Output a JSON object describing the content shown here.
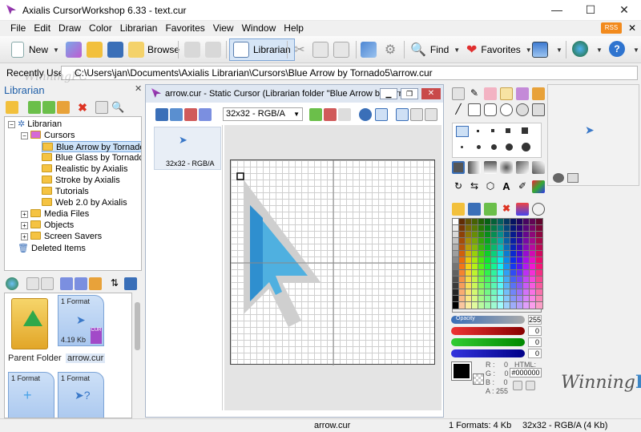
{
  "window": {
    "title": "Axialis CursorWorkshop 6.33 - text.cur",
    "controls": [
      "—",
      "☐",
      "✕"
    ]
  },
  "menu": [
    "File",
    "Edit",
    "Draw",
    "Color",
    "Librarian",
    "Favorites",
    "View",
    "Window",
    "Help"
  ],
  "rss_label": "RSS",
  "toolbar": {
    "new": "New",
    "browse": "Browse",
    "librarian": "Librarian",
    "find": "Find",
    "favorites": "Favorites"
  },
  "recent": {
    "label": "Recently Used",
    "path": "C:\\Users\\jan\\Documents\\Axialis Librarian\\Cursors\\Blue Arrow by Tornado5\\arrow.cur"
  },
  "librarian": {
    "title": "Librarian",
    "tree": {
      "root": "Librarian",
      "cursors": "Cursors",
      "items": [
        "Blue Arrow by Tornado",
        "Blue Glass by Tornado",
        "Realistic by Axialis",
        "Stroke by Axialis",
        "Tutorials",
        "Web 2.0 by Axialis"
      ],
      "media": "Media Files",
      "objects": "Objects",
      "savers": "Screen Savers",
      "deleted": "Deleted Items"
    },
    "thumbs": {
      "parent": "Parent Folder",
      "file": "arrow.cur",
      "card1_format": "1 Format",
      "card1_size": "4.19 Kb",
      "card1_ext": "CUR",
      "card2_format": "1 Format",
      "card3_format": "1 Format"
    }
  },
  "document": {
    "title": "arrow.cur - Static Cursor (Librarian folder \"Blue Arrow by Torn...",
    "format_select": "32x32 - RGB/A",
    "format_label": "32x32 - RGB/A"
  },
  "colors": {
    "opacity_label": "Opacity",
    "opacity_value": "255",
    "r_value": "0",
    "g_value": "0",
    "b_value": "0",
    "r": "R :",
    "g": "G :",
    "b": "B :",
    "a": "A :",
    "r_num": "0",
    "g_num": "0",
    "b_num": "0",
    "a_num": "255",
    "html_label": "HTML:",
    "html_value": "#000000"
  },
  "status": {
    "file": "arrow.cur",
    "formats": "1 Formats: 4 Kb",
    "format": "32x32 - RGB/A (4 Kb)"
  },
  "watermark": {
    "a": "Winning",
    "b": "PC"
  }
}
